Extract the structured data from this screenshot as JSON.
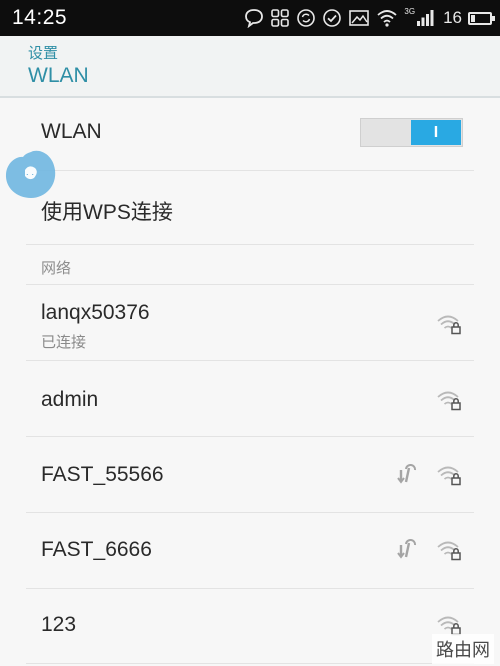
{
  "status_bar": {
    "time": "14:25",
    "network_type": "3G",
    "battery_level": "16"
  },
  "header": {
    "back_label": "设置",
    "title": "WLAN"
  },
  "wlan_row": {
    "label": "WLAN",
    "toggle_on_label": "I",
    "enabled": true
  },
  "wps_row": {
    "label": "使用WPS连接"
  },
  "network_section": {
    "title": "网络"
  },
  "networks": [
    {
      "ssid": "lanqx50376",
      "status": "已连接",
      "wps": false,
      "secured": true
    },
    {
      "ssid": "admin",
      "status": "",
      "wps": false,
      "secured": true
    },
    {
      "ssid": "FAST_55566",
      "status": "",
      "wps": true,
      "secured": true
    },
    {
      "ssid": "FAST_6666",
      "status": "",
      "wps": true,
      "secured": true
    },
    {
      "ssid": "123",
      "status": "",
      "wps": false,
      "secured": true
    }
  ],
  "watermark": "路由网",
  "colors": {
    "accent": "#2f8fa6",
    "toggle_on": "#29a9e3",
    "status_bar_bg": "#0d0d0d",
    "blob": "#6fb6e0"
  }
}
